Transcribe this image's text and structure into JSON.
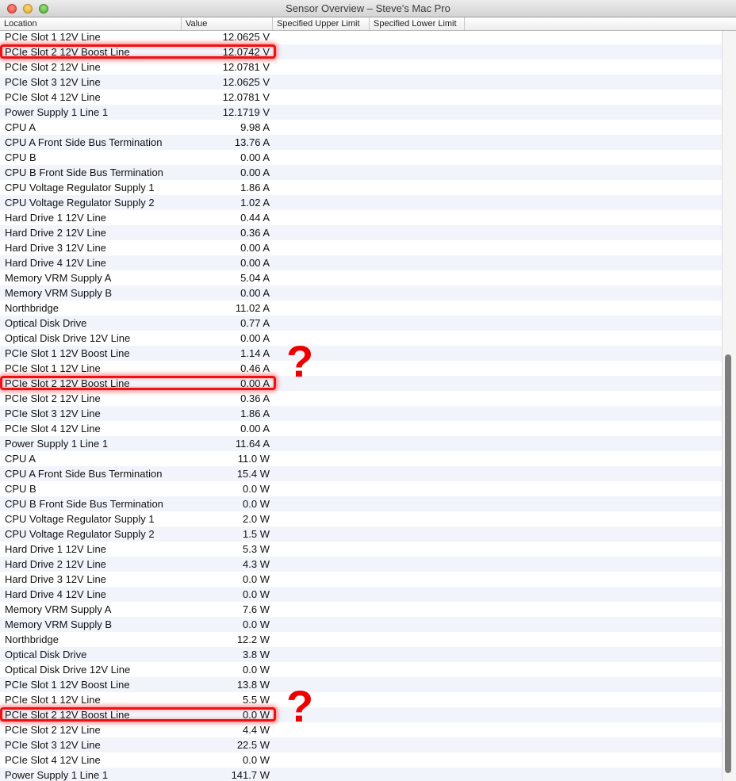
{
  "window": {
    "title": "Sensor Overview – Steve's Mac Pro"
  },
  "columns": [
    "Location",
    "Value",
    "Specified Upper Limit",
    "Specified Lower Limit"
  ],
  "rows": [
    {
      "location": "PCIe Slot 1 12V Line",
      "value": "12.0625 V"
    },
    {
      "location": "PCIe Slot 2 12V Boost Line",
      "value": "12.0742 V"
    },
    {
      "location": "PCIe Slot 2 12V Line",
      "value": "12.0781 V"
    },
    {
      "location": "PCIe Slot 3 12V Line",
      "value": "12.0625 V"
    },
    {
      "location": "PCIe Slot 4 12V Line",
      "value": "12.0781 V"
    },
    {
      "location": "Power Supply 1 Line 1",
      "value": "12.1719 V"
    },
    {
      "location": "CPU A",
      "value": "9.98 A"
    },
    {
      "location": "CPU A Front Side Bus Termination",
      "value": "13.76 A"
    },
    {
      "location": "CPU B",
      "value": "0.00 A"
    },
    {
      "location": "CPU B Front Side Bus Termination",
      "value": "0.00 A"
    },
    {
      "location": "CPU Voltage Regulator Supply 1",
      "value": "1.86 A"
    },
    {
      "location": "CPU Voltage Regulator Supply 2",
      "value": "1.02 A"
    },
    {
      "location": "Hard Drive 1 12V Line",
      "value": "0.44 A"
    },
    {
      "location": "Hard Drive 2 12V Line",
      "value": "0.36 A"
    },
    {
      "location": "Hard Drive 3 12V Line",
      "value": "0.00 A"
    },
    {
      "location": "Hard Drive 4 12V Line",
      "value": "0.00 A"
    },
    {
      "location": "Memory VRM Supply A",
      "value": "5.04 A"
    },
    {
      "location": "Memory VRM Supply B",
      "value": "0.00 A"
    },
    {
      "location": "Northbridge",
      "value": "11.02 A"
    },
    {
      "location": "Optical Disk Drive",
      "value": "0.77 A"
    },
    {
      "location": "Optical Disk Drive 12V Line",
      "value": "0.00 A"
    },
    {
      "location": "PCIe Slot 1 12V Boost Line",
      "value": "1.14 A"
    },
    {
      "location": "PCIe Slot 1 12V Line",
      "value": "0.46 A"
    },
    {
      "location": "PCIe Slot 2 12V Boost Line",
      "value": "0.00 A"
    },
    {
      "location": "PCIe Slot 2 12V Line",
      "value": "0.36 A"
    },
    {
      "location": "PCIe Slot 3 12V Line",
      "value": "1.86 A"
    },
    {
      "location": "PCIe Slot 4 12V Line",
      "value": "0.00 A"
    },
    {
      "location": "Power Supply 1 Line 1",
      "value": "11.64 A"
    },
    {
      "location": "CPU A",
      "value": "11.0 W"
    },
    {
      "location": "CPU A Front Side Bus Termination",
      "value": "15.4 W"
    },
    {
      "location": "CPU B",
      "value": "0.0 W"
    },
    {
      "location": "CPU B Front Side Bus Termination",
      "value": "0.0 W"
    },
    {
      "location": "CPU Voltage Regulator Supply 1",
      "value": "2.0 W"
    },
    {
      "location": "CPU Voltage Regulator Supply 2",
      "value": "1.5 W"
    },
    {
      "location": "Hard Drive 1 12V Line",
      "value": "5.3 W"
    },
    {
      "location": "Hard Drive 2 12V Line",
      "value": "4.3 W"
    },
    {
      "location": "Hard Drive 3 12V Line",
      "value": "0.0 W"
    },
    {
      "location": "Hard Drive 4 12V Line",
      "value": "0.0 W"
    },
    {
      "location": "Memory VRM Supply A",
      "value": "7.6 W"
    },
    {
      "location": "Memory VRM Supply B",
      "value": "0.0 W"
    },
    {
      "location": "Northbridge",
      "value": "12.2 W"
    },
    {
      "location": "Optical Disk Drive",
      "value": "3.8 W"
    },
    {
      "location": "Optical Disk Drive 12V Line",
      "value": "0.0 W"
    },
    {
      "location": "PCIe Slot 1 12V Boost Line",
      "value": "13.8 W"
    },
    {
      "location": "PCIe Slot 1 12V Line",
      "value": "5.5 W"
    },
    {
      "location": "PCIe Slot 2 12V Boost Line",
      "value": "0.0 W"
    },
    {
      "location": "PCIe Slot 2 12V Line",
      "value": "4.4 W"
    },
    {
      "location": "PCIe Slot 3 12V Line",
      "value": "22.5 W"
    },
    {
      "location": "PCIe Slot 4 12V Line",
      "value": "0.0 W"
    },
    {
      "location": "Power Supply 1 Line 1",
      "value": "141.7 W"
    }
  ],
  "highlighted_rows": [
    1,
    23,
    45
  ],
  "annotations": {
    "question_mark": "?"
  },
  "colors": {
    "highlight": "#ee1111",
    "stripe": "#f1f5fb"
  }
}
